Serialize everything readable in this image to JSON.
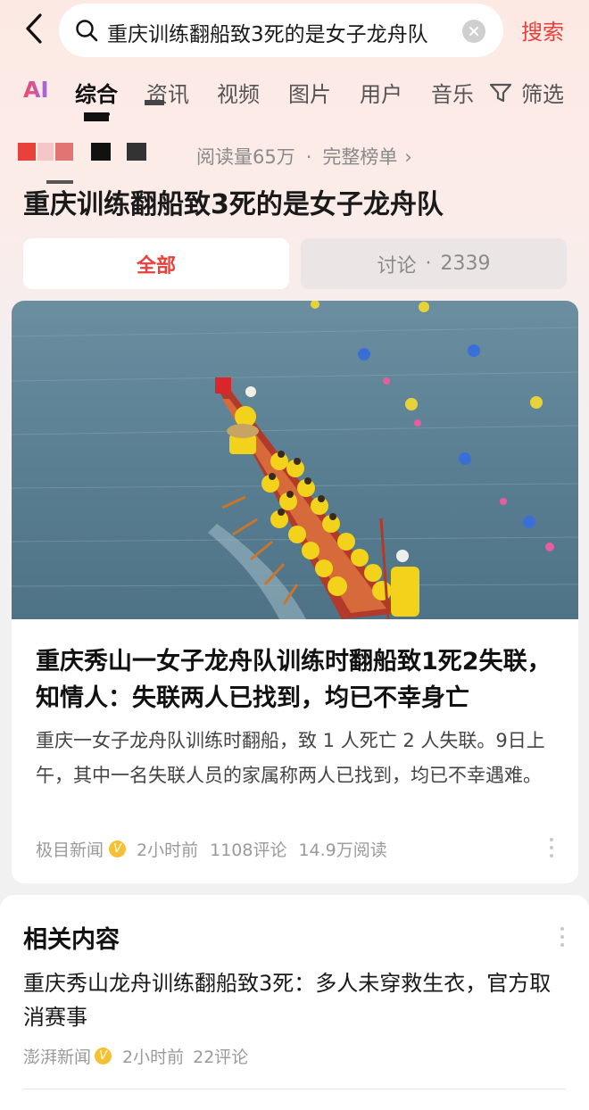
{
  "search": {
    "query": "重庆训练翻船致3死的是女子龙舟队",
    "button_label": "搜索"
  },
  "tabs": [
    {
      "label": "AI"
    },
    {
      "label": "综合"
    },
    {
      "label": "资讯"
    },
    {
      "label": "视频"
    },
    {
      "label": "图片"
    },
    {
      "label": "用户"
    },
    {
      "label": "音乐"
    },
    {
      "label": "筛选"
    }
  ],
  "hotlist": {
    "read_count": "阅读量65万",
    "separator": "·",
    "full_list": "完整榜单",
    "chevron": "›"
  },
  "topic": {
    "title": "重庆训练翻船致3死的是女子龙舟队"
  },
  "segments": {
    "all": "全部",
    "discussion": "讨论",
    "separator": "·",
    "discussion_count": "2339"
  },
  "article": {
    "headline": "重庆秀山一女子龙舟队训练时翻船致1死2失联，知情人：失联两人已找到，均已不幸身亡",
    "summary": "重庆一女子龙舟队训练时翻船，致 1 人死亡 2 人失联。9日上午，其中一名失联人员的家属称两人已找到，均已不幸遇难。",
    "source": "极目新闻",
    "time": "2小时前",
    "comments": "1108评论",
    "reads": "14.9万阅读"
  },
  "related": {
    "title": "相关内容",
    "items": [
      {
        "title": "重庆秀山龙舟训练翻船致3死：多人未穿救生衣，官方取消赛事",
        "source": "澎湃新闻",
        "time": "2小时前",
        "comments": "22评论"
      }
    ]
  },
  "colors": {
    "accent": "#e8403a",
    "verified": "#f5c034"
  }
}
